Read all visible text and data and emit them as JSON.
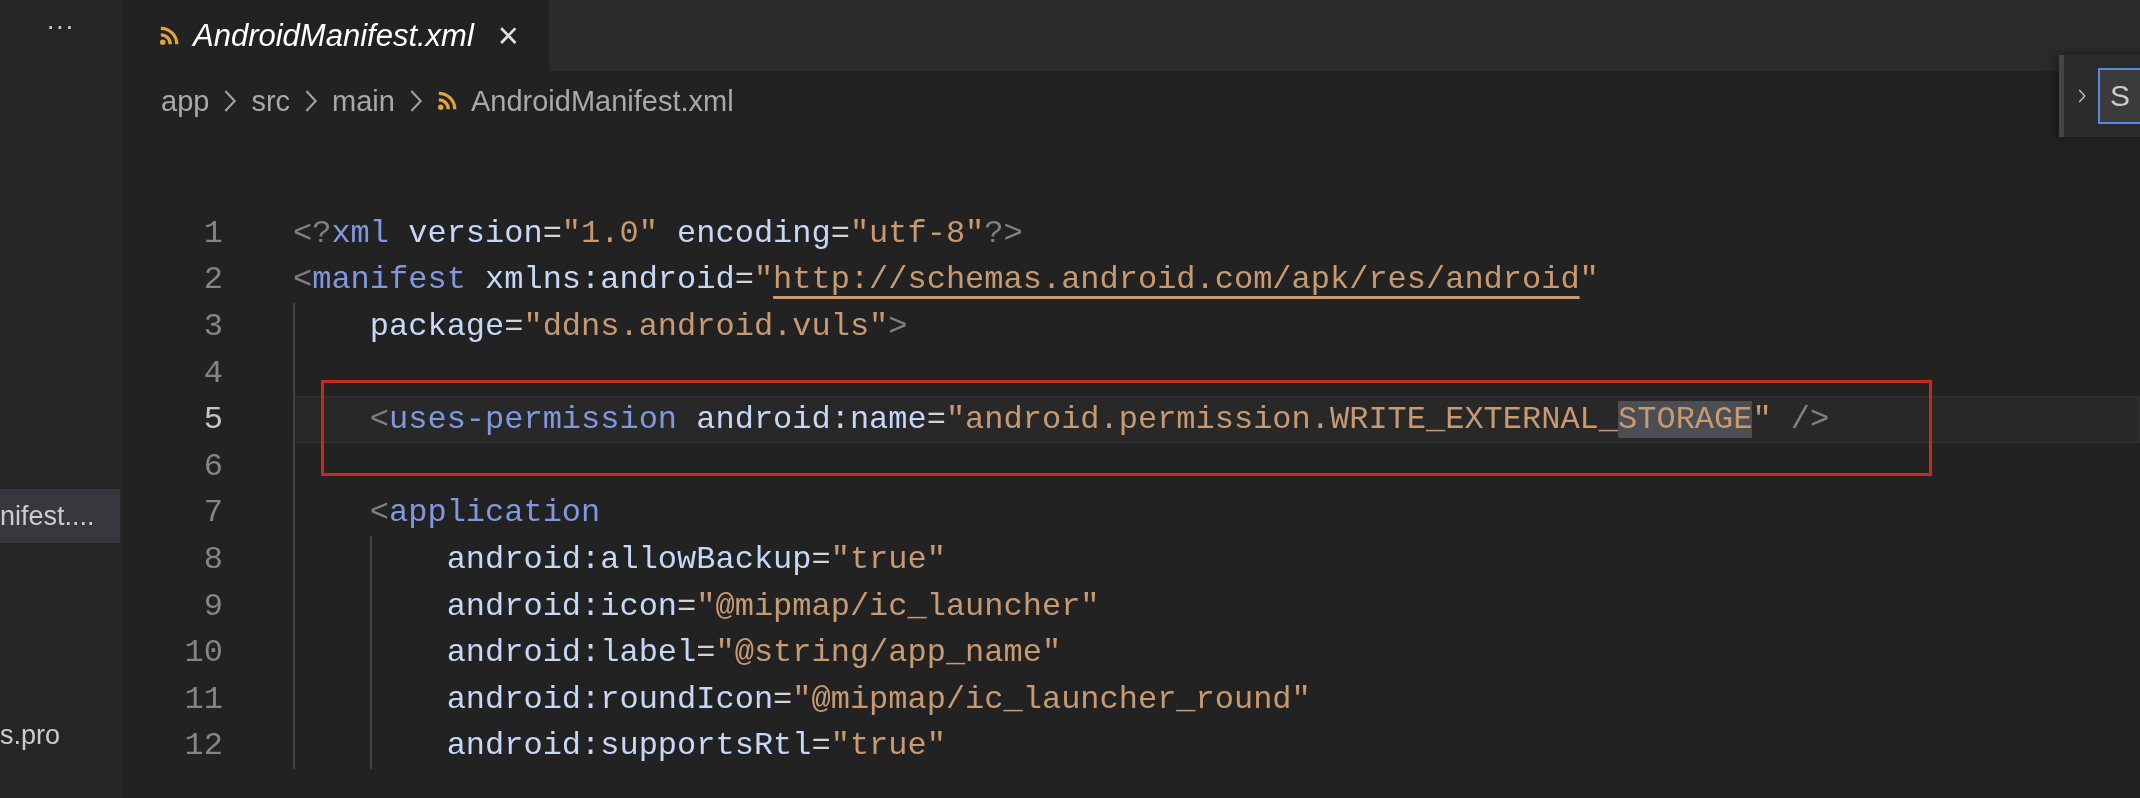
{
  "sidebar": {
    "more": "···",
    "items": [
      {
        "label": "nifest....",
        "selected": true
      },
      {
        "label": "s.pro",
        "selected": false
      }
    ]
  },
  "tabs": [
    {
      "label": "AndroidManifest.xml",
      "selected": true,
      "close": "×"
    }
  ],
  "breadcrumb": [
    "app",
    "src",
    "main",
    "AndroidManifest.xml"
  ],
  "find_widget": {
    "value": "S"
  },
  "lines": [
    {
      "number": "1",
      "current": false,
      "boxed": false,
      "tokens": [
        {
          "kind": "bracket",
          "text": "<?"
        },
        {
          "kind": "tag",
          "text": "xml"
        },
        {
          "kind": "attr",
          "text": " version"
        },
        {
          "kind": "eq",
          "text": "="
        },
        {
          "kind": "string",
          "text": "\"1.0\""
        },
        {
          "kind": "attr",
          "text": " encoding"
        },
        {
          "kind": "eq",
          "text": "="
        },
        {
          "kind": "string",
          "text": "\"utf-8\""
        },
        {
          "kind": "bracket",
          "text": "?>"
        }
      ]
    },
    {
      "number": "2",
      "current": false,
      "boxed": false,
      "tokens": [
        {
          "kind": "bracket",
          "text": "<"
        },
        {
          "kind": "tag",
          "text": "manifest"
        },
        {
          "kind": "attr",
          "text": " xmlns:android"
        },
        {
          "kind": "eq",
          "text": "="
        },
        {
          "kind": "string",
          "text": "\""
        },
        {
          "kind": "link",
          "text": "http://schemas.android.com/apk/res/android"
        },
        {
          "kind": "string",
          "text": "\""
        }
      ]
    },
    {
      "number": "3",
      "current": false,
      "boxed": false,
      "tokens": [
        {
          "kind": "attr",
          "text": "    package"
        },
        {
          "kind": "eq",
          "text": "="
        },
        {
          "kind": "string",
          "text": "\"ddns.android.vuls\""
        },
        {
          "kind": "bracket",
          "text": ">"
        }
      ]
    },
    {
      "number": "4",
      "current": false,
      "boxed": false
    },
    {
      "number": "5",
      "current": true,
      "boxed": true,
      "tokens": [
        {
          "kind": "bracket",
          "text": "    <"
        },
        {
          "kind": "tag",
          "text": "uses-permission"
        },
        {
          "kind": "attr",
          "text": " android:name"
        },
        {
          "kind": "eq",
          "text": "="
        },
        {
          "kind": "string",
          "text": "\"android.permission.WRITE_EXTERNAL_"
        },
        {
          "kind": "match",
          "text": "STORAGE"
        },
        {
          "kind": "string",
          "text": "\""
        },
        {
          "kind": "bracket",
          "text": " />"
        }
      ]
    },
    {
      "number": "6",
      "current": false,
      "boxed": false
    },
    {
      "number": "7",
      "current": false,
      "boxed": false,
      "tokens": [
        {
          "kind": "bracket",
          "text": "    <"
        },
        {
          "kind": "tag",
          "text": "application"
        }
      ]
    },
    {
      "number": "8",
      "current": false,
      "boxed": false,
      "tokens": [
        {
          "kind": "attr",
          "text": "        android:allowBackup"
        },
        {
          "kind": "eq",
          "text": "="
        },
        {
          "kind": "string",
          "text": "\"true\""
        }
      ]
    },
    {
      "number": "9",
      "current": false,
      "boxed": false,
      "tokens": [
        {
          "kind": "attr",
          "text": "        android:icon"
        },
        {
          "kind": "eq",
          "text": "="
        },
        {
          "kind": "string",
          "text": "\"@mipmap/ic_launcher\""
        }
      ]
    },
    {
      "number": "10",
      "current": false,
      "boxed": false,
      "tokens": [
        {
          "kind": "attr",
          "text": "        android:label"
        },
        {
          "kind": "eq",
          "text": "="
        },
        {
          "kind": "string",
          "text": "\"@string/app_name\""
        }
      ]
    },
    {
      "number": "11",
      "current": false,
      "boxed": false,
      "tokens": [
        {
          "kind": "attr",
          "text": "        android:roundIcon"
        },
        {
          "kind": "eq",
          "text": "="
        },
        {
          "kind": "string",
          "text": "\"@mipmap/ic_launcher_round\""
        }
      ]
    },
    {
      "number": "12",
      "current": false,
      "boxed": false,
      "tokens": [
        {
          "kind": "attr",
          "text": "        android:supportsRtl"
        },
        {
          "kind": "eq",
          "text": "="
        },
        {
          "kind": "string",
          "text": "\"true\""
        }
      ]
    }
  ]
}
